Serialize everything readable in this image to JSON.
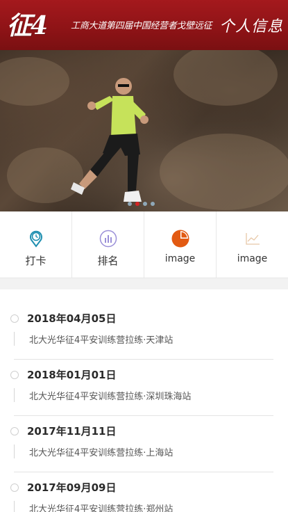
{
  "header": {
    "logo": "征4",
    "slogan": "工商大道第四届中国经营者戈壁远征",
    "profile_link": "个人信息",
    "color": "#8d1316"
  },
  "banner": {
    "slide_count": 4,
    "active_slide": 2,
    "dot_active_color": "#d52424"
  },
  "menu": {
    "items": [
      {
        "label": "打卡",
        "icon": "clock-pin-icon"
      },
      {
        "label": "排名",
        "icon": "bar-chart-circle-icon"
      },
      {
        "label": "image",
        "icon": "pie-chart-icon"
      },
      {
        "label": "image",
        "icon": "line-chart-icon"
      }
    ]
  },
  "timeline": {
    "events": [
      {
        "date": "2018年04月05日",
        "desc": "北大光华征4平安训练营拉练·天津站"
      },
      {
        "date": "2018年01月01日",
        "desc": "北大光华征4平安训练营拉练·深圳珠海站"
      },
      {
        "date": "2017年11月11日",
        "desc": "北大光华征4平安训练营拉练·上海站"
      },
      {
        "date": "2017年09月09日",
        "desc": "北大光华征4平安训练营拉练·郑州站"
      }
    ]
  }
}
